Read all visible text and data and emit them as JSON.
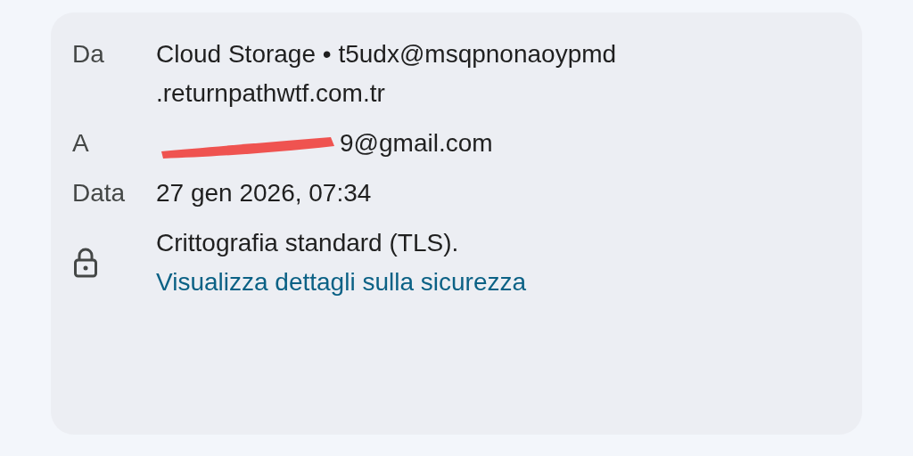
{
  "details": [
    {
      "kind": "sender",
      "label": "Da",
      "name": "Cloud Storage",
      "separator": "•",
      "address_lines": [
        "t5udx@msqpnonaoypmd",
        ".returnpathwtf.com.tr"
      ]
    },
    {
      "kind": "recipient",
      "label": "A",
      "address": "9@gmail.com",
      "redacted": true
    },
    {
      "kind": "date",
      "label": "Data",
      "value": "27 gen 2026, 07:34"
    },
    {
      "kind": "security",
      "text": "Crittografia standard (TLS).",
      "link": "Visualizza dettagli sulla sicurezza"
    }
  ]
}
